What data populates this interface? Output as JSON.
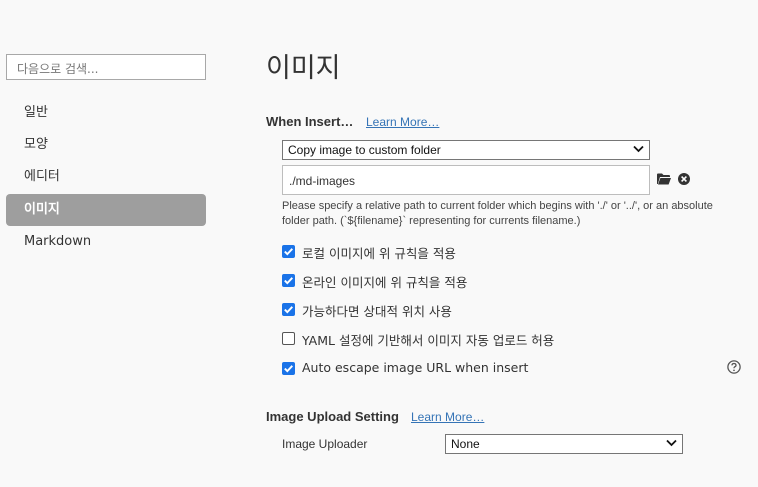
{
  "sidebar": {
    "search_placeholder": "다음으로 검색...",
    "items": [
      {
        "label": "일반"
      },
      {
        "label": "모양"
      },
      {
        "label": "에디터"
      },
      {
        "label": "이미지"
      },
      {
        "label": "Markdown"
      }
    ],
    "active_index": 3
  },
  "main": {
    "title": "이미지",
    "when_insert": {
      "heading": "When Insert…",
      "learn_more": "Learn More…",
      "action_select": "Copy image to custom folder",
      "path_value": "./md-images",
      "hint": "Please specify a relative path to current folder which begins with './' or '../', or an absolute folder path. (`${filename}` representing for currents filename.)",
      "options": [
        {
          "label": "로컬 이미지에 위 규칙을 적용",
          "checked": true
        },
        {
          "label": "온라인 이미지에 위 규칙을 적용",
          "checked": true
        },
        {
          "label": "가능하다면 상대적 위치 사용",
          "checked": true
        },
        {
          "label": "YAML 설정에 기반해서 이미지 자동 업로드 허용",
          "checked": false
        },
        {
          "label": "Auto escape image URL when insert",
          "checked": true
        }
      ]
    },
    "upload": {
      "heading": "Image Upload Setting",
      "learn_more": "Learn More…",
      "uploader_label": "Image Uploader",
      "uploader_value": "None"
    }
  },
  "colors": {
    "accent": "#1a73e8",
    "link": "#3574b6",
    "sidebar_active": "#9e9e9e"
  }
}
